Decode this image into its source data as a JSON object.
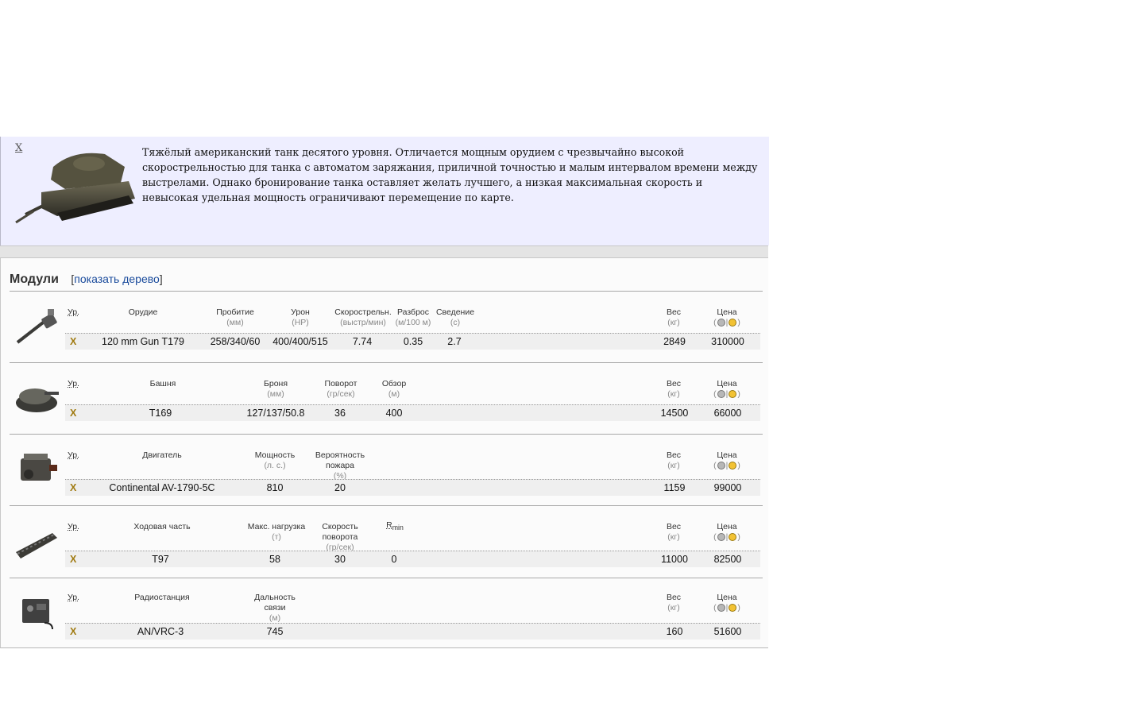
{
  "intro": {
    "close_label": "X",
    "description": "Тяжёлый американский танк десятого уровня. Отличается мощным орудием с чрезвычайно высокой скорострельностью для танка с автоматом заряжания, приличной точностью и малым интервалом времени между выстрелами. Однако бронирование танка оставляет желать лучшего, а низкая максимальная скорость и невысокая удельная мощность ограничивают перемещение по карте."
  },
  "modules": {
    "title": "Модули",
    "tree_open": "[",
    "tree_link": "показать дерево",
    "tree_close": "]",
    "common": {
      "level": "Ур.",
      "weight": "Вес",
      "weight_unit": "(кг)",
      "price": "Цена"
    },
    "gun": {
      "icon": "gun-icon",
      "headers": {
        "name": "Орудие",
        "pen": "Пробитие",
        "pen_unit": "(мм)",
        "dmg": "Урон",
        "dmg_unit": "(HP)",
        "rof": "Скорострельн.",
        "rof_unit": "(выстр/мин)",
        "disp": "Разброс",
        "disp_unit": "(м/100 м)",
        "aim": "Сведение",
        "aim_unit": "(с)"
      },
      "row": {
        "level": "X",
        "name": "120 mm Gun T179",
        "pen": "258/340/60",
        "dmg": "400/400/515",
        "rof": "7.74",
        "disp": "0.35",
        "aim": "2.7",
        "weight": "2849",
        "price": "310000"
      }
    },
    "turret": {
      "icon": "turret-icon",
      "headers": {
        "name": "Башня",
        "armor": "Броня",
        "armor_unit": "(мм)",
        "traverse": "Поворот",
        "traverse_unit": "(гр/сек)",
        "view": "Обзор",
        "view_unit": "(м)"
      },
      "row": {
        "level": "X",
        "name": "T169",
        "armor": "127/137/50.8",
        "traverse": "36",
        "view": "400",
        "weight": "14500",
        "price": "66000"
      }
    },
    "engine": {
      "icon": "engine-icon",
      "headers": {
        "name": "Двигатель",
        "power": "Мощность",
        "power_unit": "(л. с.)",
        "fire_1": "Вероятность",
        "fire_2": "пожара",
        "fire_unit": "(%)"
      },
      "row": {
        "level": "X",
        "name": "Continental AV-1790-5C",
        "power": "810",
        "fire": "20",
        "weight": "1159",
        "price": "99000"
      }
    },
    "suspension": {
      "icon": "tracks-icon",
      "headers": {
        "name": "Ходовая часть",
        "load": "Макс. нагрузка",
        "load_unit": "(т)",
        "trav_1": "Скорость",
        "trav_2": "поворота",
        "trav_unit": "(гр/сек)",
        "rmin": "R",
        "rmin_sub": "min"
      },
      "row": {
        "level": "X",
        "name": "T97",
        "load": "58",
        "trav": "30",
        "rmin": "0",
        "weight": "11000",
        "price": "82500"
      }
    },
    "radio": {
      "icon": "radio-icon",
      "headers": {
        "name": "Радиостанция",
        "range_1": "Дальность",
        "range_2": "связи",
        "range_unit": "(м)"
      },
      "row": {
        "level": "X",
        "name": "AN/VRC-3",
        "range": "745",
        "weight": "160",
        "price": "51600"
      }
    }
  }
}
